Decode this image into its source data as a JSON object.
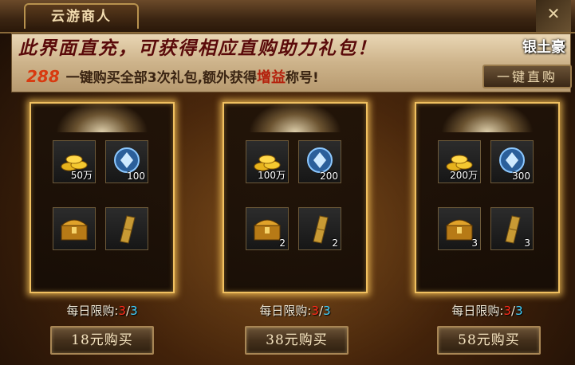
{
  "window": {
    "title": "云游商人",
    "brand_stamp": "银土豪"
  },
  "banner": {
    "headline": "此界面直充，可获得相应直购助力礼包！",
    "promo_price": "288",
    "promo_text_before": "一键购买全部3次礼包,额外获得",
    "promo_highlight": "增益",
    "promo_text_after": "称号!",
    "onekey_button": "一键直购"
  },
  "packs": [
    {
      "items": [
        {
          "icon": "gold-coins-icon",
          "qty": "50万"
        },
        {
          "icon": "blue-gem-icon",
          "qty": "100"
        },
        {
          "icon": "treasure-chest-icon",
          "qty": ""
        },
        {
          "icon": "golden-scroll-icon",
          "qty": ""
        }
      ],
      "limit_label": "每日限购:",
      "limit_current": "3",
      "limit_sep": "/",
      "limit_total": "3",
      "buy_label": "18元购买"
    },
    {
      "items": [
        {
          "icon": "gold-coins-icon",
          "qty": "100万"
        },
        {
          "icon": "blue-gem-icon",
          "qty": "200"
        },
        {
          "icon": "treasure-chest-icon",
          "qty": "2"
        },
        {
          "icon": "golden-scroll-icon",
          "qty": "2"
        }
      ],
      "limit_label": "每日限购:",
      "limit_current": "3",
      "limit_sep": "/",
      "limit_total": "3",
      "buy_label": "38元购买"
    },
    {
      "items": [
        {
          "icon": "gold-coins-icon",
          "qty": "200万"
        },
        {
          "icon": "blue-gem-icon",
          "qty": "300"
        },
        {
          "icon": "treasure-chest-icon",
          "qty": "3"
        },
        {
          "icon": "golden-scroll-icon",
          "qty": "3"
        }
      ],
      "limit_label": "每日限购:",
      "limit_current": "3",
      "limit_sep": "/",
      "limit_total": "3",
      "buy_label": "58元购买"
    }
  ],
  "colors": {
    "card_glow": "#f0c060",
    "limit_current": "#ff2a1a",
    "limit_total": "#3fd0ff",
    "banner_text": "#5a0a0a"
  }
}
